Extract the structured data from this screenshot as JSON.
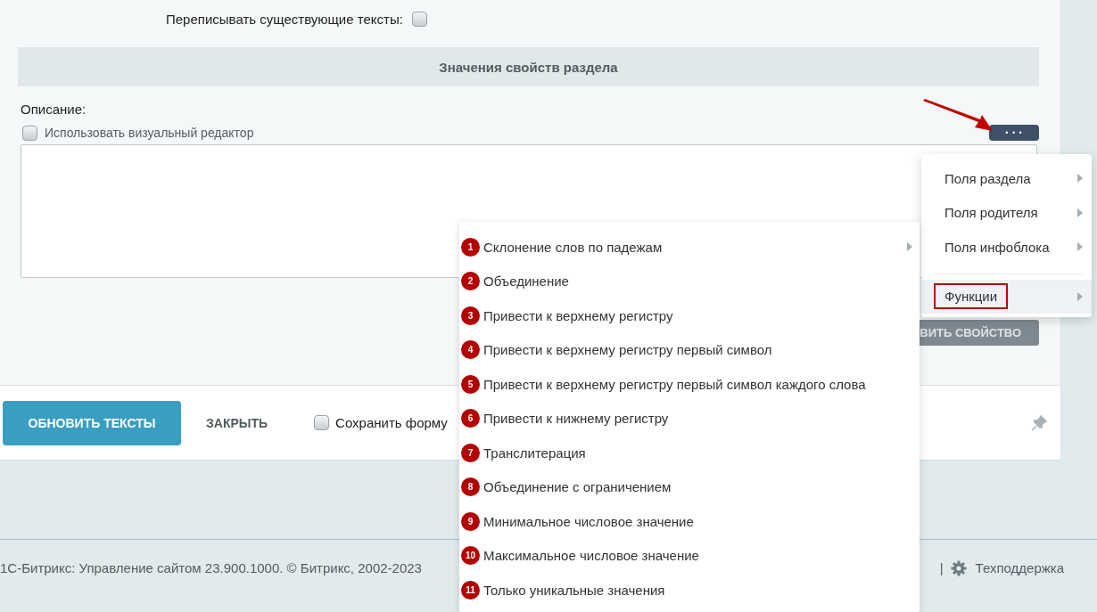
{
  "overwrite": {
    "label": "Переписывать существующие тексты:",
    "checked": false
  },
  "section_header": "Значения свойств раздела",
  "description": {
    "label": "Описание:",
    "visual_editor": {
      "label": "Использовать визуальный редактор",
      "checked": false
    },
    "menu_button": "• • •"
  },
  "add_property_button": "ВИТЬ СВОЙСТВО",
  "buttons": {
    "primary": "ОБНОВИТЬ ТЕКСТЫ",
    "close": "ЗАКРЫТЬ",
    "save_form": {
      "label": "Сохранить форму",
      "checked": false
    }
  },
  "footer": {
    "copyright": "1С-Битрикс: Управление сайтом 23.900.1000. © Битрикс, 2002-2023",
    "separator": "|",
    "support": "Техподдержка"
  },
  "menu": {
    "items": [
      {
        "kind": "item",
        "label": "Поля раздела",
        "submenu": true,
        "highlighted": false,
        "outlined": false
      },
      {
        "kind": "item",
        "label": "Поля родителя",
        "submenu": true,
        "highlighted": false,
        "outlined": false
      },
      {
        "kind": "item",
        "label": "Поля инфоблока",
        "submenu": true,
        "highlighted": false,
        "outlined": false
      },
      {
        "kind": "separator"
      },
      {
        "kind": "item",
        "label": "Функции",
        "submenu": true,
        "highlighted": true,
        "outlined": true
      }
    ]
  },
  "submenu": {
    "items": [
      {
        "badge": "1",
        "label": "Склонение слов по падежам",
        "submenu": true
      },
      {
        "badge": "2",
        "label": "Объединение",
        "submenu": false
      },
      {
        "badge": "3",
        "label": "Привести к верхнему регистру",
        "submenu": false
      },
      {
        "badge": "4",
        "label": "Привести к верхнему регистру первый символ",
        "submenu": false
      },
      {
        "badge": "5",
        "label": "Привести к верхнему регистру первый символ каждого слова",
        "submenu": false
      },
      {
        "badge": "6",
        "label": "Привести к нижнему регистру",
        "submenu": false
      },
      {
        "badge": "7",
        "label": "Транслитерация",
        "submenu": false
      },
      {
        "badge": "8",
        "label": "Объединение с ограничением",
        "submenu": false
      },
      {
        "badge": "9",
        "label": "Минимальное числовое значение",
        "submenu": false
      },
      {
        "badge": "10",
        "label": "Максимальное числовое значение",
        "submenu": false
      },
      {
        "badge": "11",
        "label": "Только уникальные значения",
        "submenu": false
      }
    ]
  }
}
